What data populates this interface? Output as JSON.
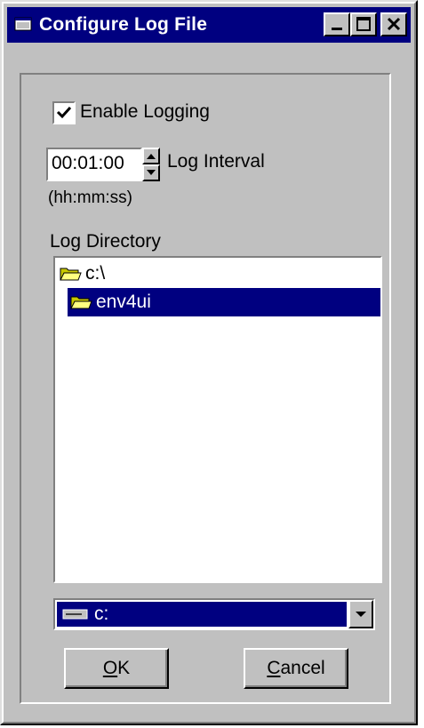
{
  "window": {
    "title": "Configure Log File",
    "buttons": {
      "minimize": "minimize-icon",
      "maximize": "maximize-icon",
      "close": "close-icon"
    }
  },
  "enable_logging": {
    "label": "Enable Logging",
    "checked": true
  },
  "log_interval": {
    "value": "00:01:00",
    "label": "Log Interval",
    "format_hint": "(hh:mm:ss)"
  },
  "log_directory": {
    "label": "Log Directory",
    "items": [
      {
        "label": "c:\\",
        "icon": "open-folder-icon",
        "selected": false
      },
      {
        "label": "env4ui",
        "icon": "open-folder-icon",
        "selected": true
      }
    ]
  },
  "drive": {
    "selected": "c:",
    "icon": "drive-icon"
  },
  "buttons": {
    "ok": {
      "accel": "O",
      "rest": "K"
    },
    "cancel": {
      "accel": "C",
      "rest": "ancel"
    }
  },
  "colors": {
    "face": "#c0c0c0",
    "titlebar": "#000080",
    "selection": "#000080"
  }
}
